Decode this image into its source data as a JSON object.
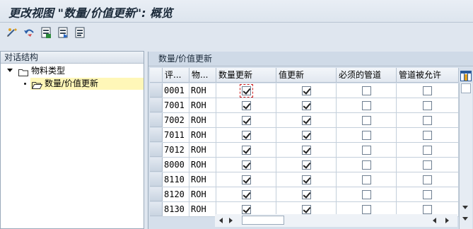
{
  "window": {
    "title": "更改视图 \"数量/价值更新\": 概览"
  },
  "toolbar": {
    "buttons": [
      "edit-icon",
      "undo-icon",
      "save-list-icon",
      "forward-icon",
      "print-list-icon"
    ]
  },
  "left_pane": {
    "header": "对话结构",
    "tree": [
      {
        "label": "物料类型",
        "level": 0,
        "expanded": true
      },
      {
        "label": "数量/价值更新",
        "level": 1,
        "selected": true
      }
    ]
  },
  "table": {
    "title": "数量/价值更新",
    "columns": [
      "评...",
      "物...",
      "数量更新",
      "值更新",
      "必须的管道",
      "管道被允许"
    ],
    "rows": [
      {
        "val_area": "0001",
        "mat_type": "ROH",
        "qty_update": true,
        "val_update": true,
        "pipe_mand": false,
        "pipe_allowed": false
      },
      {
        "val_area": "7001",
        "mat_type": "ROH",
        "qty_update": true,
        "val_update": true,
        "pipe_mand": false,
        "pipe_allowed": false
      },
      {
        "val_area": "7002",
        "mat_type": "ROH",
        "qty_update": true,
        "val_update": true,
        "pipe_mand": false,
        "pipe_allowed": false
      },
      {
        "val_area": "7011",
        "mat_type": "ROH",
        "qty_update": true,
        "val_update": true,
        "pipe_mand": false,
        "pipe_allowed": false
      },
      {
        "val_area": "7012",
        "mat_type": "ROH",
        "qty_update": true,
        "val_update": true,
        "pipe_mand": false,
        "pipe_allowed": false
      },
      {
        "val_area": "8000",
        "mat_type": "ROH",
        "qty_update": true,
        "val_update": true,
        "pipe_mand": false,
        "pipe_allowed": false
      },
      {
        "val_area": "8110",
        "mat_type": "ROH",
        "qty_update": true,
        "val_update": true,
        "pipe_mand": false,
        "pipe_allowed": false
      },
      {
        "val_area": "8120",
        "mat_type": "ROH",
        "qty_update": true,
        "val_update": true,
        "pipe_mand": false,
        "pipe_allowed": false
      },
      {
        "val_area": "8130",
        "mat_type": "ROH",
        "qty_update": true,
        "val_update": true,
        "pipe_mand": false,
        "pipe_allowed": false
      }
    ],
    "focused_cell": {
      "row": 0,
      "column": "数量更新"
    }
  },
  "colors": {
    "accent": "#d02020",
    "header_bg": "#cfdae7",
    "selected_node": "#fff7b8"
  }
}
